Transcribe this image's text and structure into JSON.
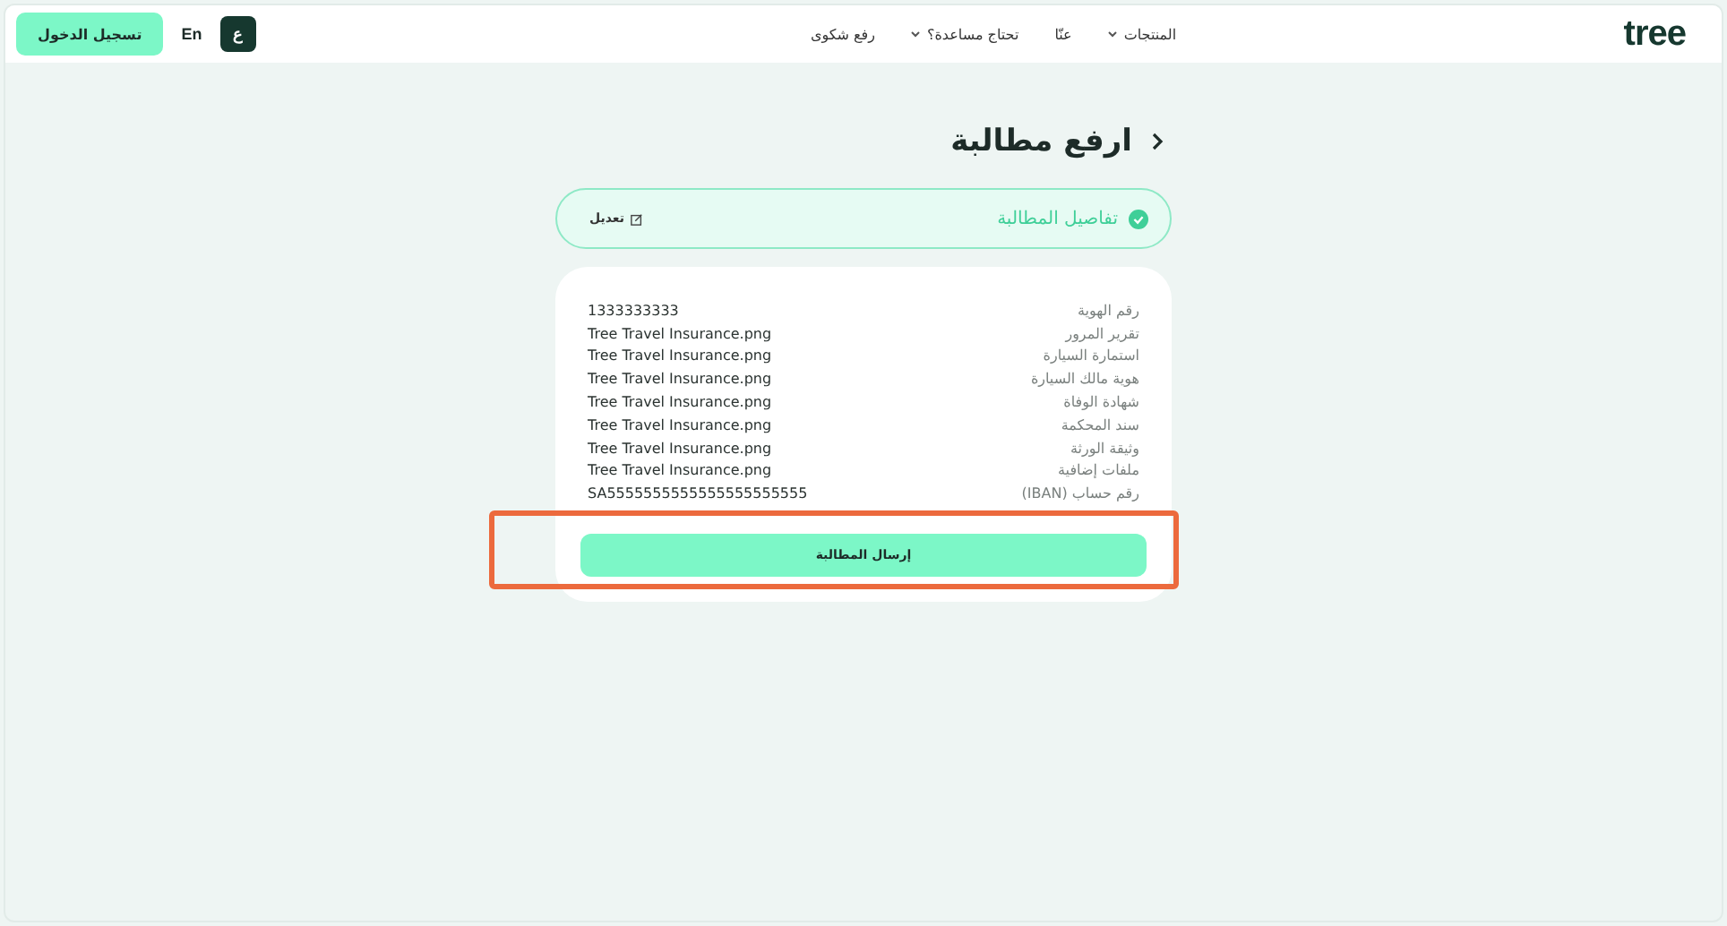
{
  "header": {
    "logo": "tree",
    "nav": [
      {
        "label": "المنتجات",
        "dropdown": true
      },
      {
        "label": "عنّا",
        "dropdown": false
      },
      {
        "label": "تحتاج مساعدة؟",
        "dropdown": true
      },
      {
        "label": "رفع شكوى",
        "dropdown": false
      }
    ],
    "lang_buttons": [
      {
        "label": "ع",
        "selected": true
      },
      {
        "label": "En",
        "selected": false
      }
    ],
    "login": "تسجيل الدخول"
  },
  "page_title": "ارفع مطالبة",
  "step": {
    "label": "تفاصيل المطالبة",
    "done": true,
    "edit": "تعديل"
  },
  "details": [
    {
      "label": "رقم الهوية",
      "value": "1333333333"
    },
    {
      "label": "تقرير المرور",
      "value": "Tree Travel Insurance.png"
    },
    {
      "label": "استمارة السيارة",
      "value": "Tree Travel Insurance.png"
    },
    {
      "label": "هوية مالك السيارة",
      "value": "Tree Travel Insurance.png"
    },
    {
      "label": "شهادة الوفاة",
      "value": "Tree Travel Insurance.png"
    },
    {
      "label": "سند المحكمة",
      "value": "Tree Travel Insurance.png"
    },
    {
      "label": "وثيقة الورثة",
      "value": "Tree Travel Insurance.png"
    },
    {
      "label": "ملفات إضافية",
      "value": "Tree Travel Insurance.png"
    },
    {
      "label": "رقم حساب (IBAN)",
      "value": "SA5555555555555555555555"
    }
  ],
  "submit": "إرسال المطالبة"
}
